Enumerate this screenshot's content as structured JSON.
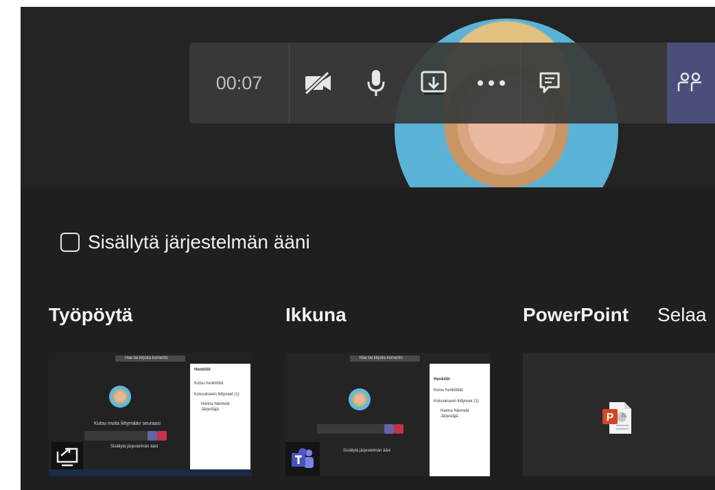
{
  "meeting": {
    "timer": "00:07",
    "toolbar_icons": [
      "video-off-icon",
      "microphone-icon",
      "share-tray-icon",
      "more-icon",
      "chat-icon",
      "people-icon"
    ]
  },
  "share": {
    "include_audio_label": "Sisällytä järjestelmän ääni",
    "sections": [
      "Työpöytä",
      "Ikkuna",
      "PowerPoint",
      "Selaa"
    ]
  },
  "thumbnails": {
    "desktop": {
      "search": "Hae tai kirjoita komento",
      "panel_title": "Henkilöt",
      "invite": "Kutsu henkilöitä",
      "meeting_label": "Kokoukseen liittyneet (1)",
      "person": "Hanna Niemelä",
      "role": "Järjestäjä",
      "invite_text": "Kutsu muita liittymään seuraasi",
      "checkbox_text": "Sisällytä järjestelmän ääni"
    },
    "window": {
      "search": "Hae tai kirjoita komento",
      "panel_title": "Henkilöt",
      "invite": "Kutsu henkilöitä",
      "meeting_label": "Kokoukseen liittyneet (1)",
      "person": "Hanna Niemelä",
      "role": "Järjestäjä",
      "checkbox_text": "Sisällytä järjestelmän ääni"
    }
  },
  "colors": {
    "toolbar": "#3a3a3a",
    "people_button": "#4b4d7a",
    "background": "#1f1f1f",
    "powerpoint": "#d24726",
    "teams": "#5059c9"
  }
}
